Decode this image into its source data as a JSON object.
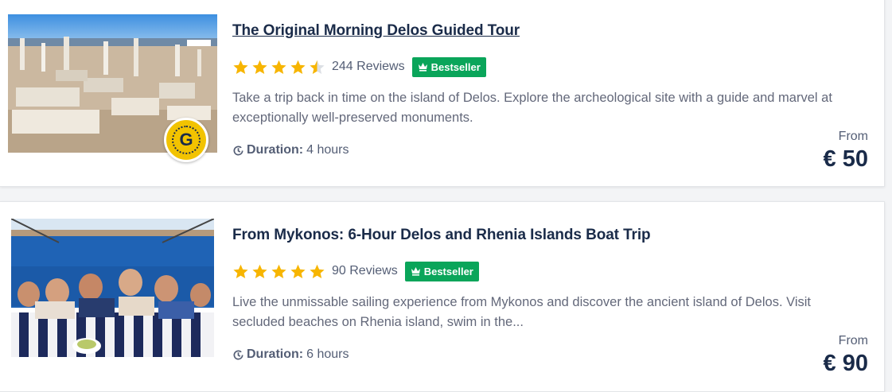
{
  "colors": {
    "star": "#f7b500",
    "bestseller_bg": "#0aa55a",
    "title": "#1a2b49",
    "text": "#63687a"
  },
  "tours": [
    {
      "title": "The Original Morning Delos Guided Tour",
      "rating": 4.5,
      "reviews": "244 Reviews",
      "badge": "Bestseller",
      "description": "Take a trip back in time on the island of Delos. Explore the archeological site with a guide and marvel at exceptionally well-preserved monuments.",
      "duration_label": "Duration:",
      "duration_value": "4 hours",
      "price_prefix": "From",
      "price": "€ 50",
      "image": "delos-ruins-photo",
      "original_badge_letter": "G"
    },
    {
      "title": "From Mykonos: 6-Hour Delos and Rhenia Islands Boat Trip",
      "rating": 5,
      "reviews": "90 Reviews",
      "badge": "Bestseller",
      "description": "Live the unmissable sailing experience from Mykonos and discover the ancient island of Delos. Visit secluded beaches on Rhenia island, swim in the...",
      "duration_label": "Duration:",
      "duration_value": "6 hours",
      "price_prefix": "From",
      "price": "€ 90",
      "image": "boat-group-photo"
    }
  ]
}
